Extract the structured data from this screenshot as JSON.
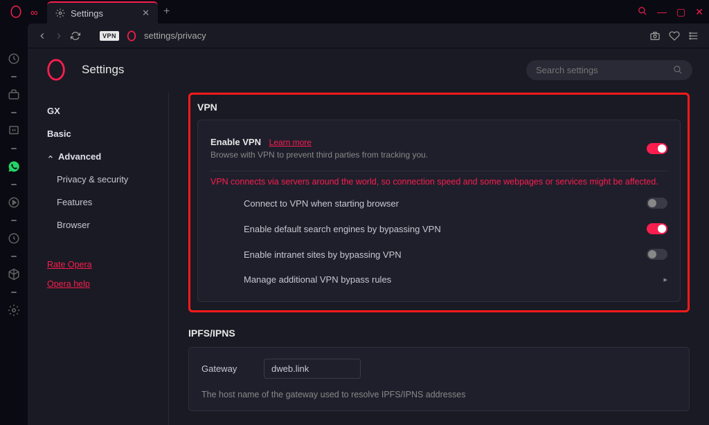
{
  "tab_title": "Settings",
  "url_text": "settings/privacy",
  "vpn_badge": "VPN",
  "page_title": "Settings",
  "search_placeholder": "Search settings",
  "sidebar": {
    "gx": "GX",
    "basic": "Basic",
    "advanced": "Advanced",
    "privacy": "Privacy & security",
    "features": "Features",
    "browser": "Browser",
    "rate": "Rate Opera",
    "help": "Opera help"
  },
  "vpn": {
    "section": "VPN",
    "enable_title": "Enable VPN",
    "learn_more": "Learn more",
    "enable_desc": "Browse with VPN to prevent third parties from tracking you.",
    "warning": "VPN connects via servers around the world, so connection speed and some webpages or services might be affected.",
    "connect_start": "Connect to VPN when starting browser",
    "default_search": "Enable default search engines by bypassing VPN",
    "intranet": "Enable intranet sites by bypassing VPN",
    "manage": "Manage additional VPN bypass rules",
    "enable_on": true,
    "connect_start_on": false,
    "default_search_on": true,
    "intranet_on": false
  },
  "ipfs": {
    "section": "IPFS/IPNS",
    "gateway_label": "Gateway",
    "gateway_value": "dweb.link",
    "desc": "The host name of the gateway used to resolve IPFS/IPNS addresses"
  },
  "colors": {
    "accent": "#fa1e4e"
  }
}
